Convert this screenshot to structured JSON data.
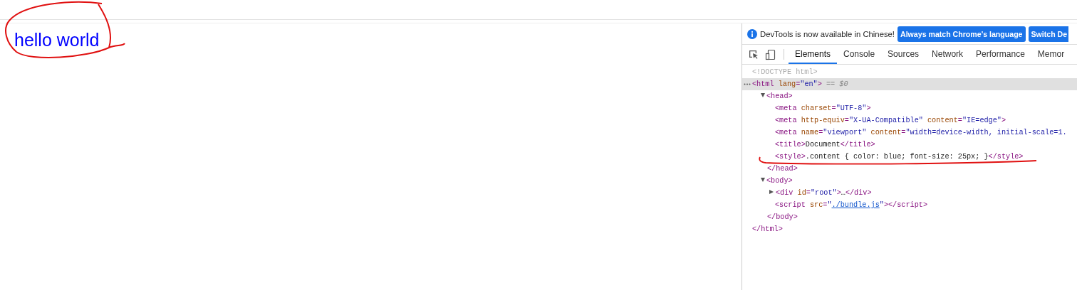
{
  "page": {
    "content": "hello world"
  },
  "devtools": {
    "infobar": {
      "message": "DevTools is now available in Chinese!",
      "buttons": [
        "Always match Chrome's language",
        "Switch De"
      ]
    },
    "tabs": [
      {
        "label": "Elements",
        "selected": true
      },
      {
        "label": "Console",
        "selected": false
      },
      {
        "label": "Sources",
        "selected": false
      },
      {
        "label": "Network",
        "selected": false
      },
      {
        "label": "Performance",
        "selected": false
      },
      {
        "label": "Memor",
        "selected": false
      }
    ],
    "dom_tree": [
      {
        "open": [
          {
            "kind": "doctype",
            "text": "<!DOCTYPE html>"
          }
        ]
      },
      {
        "selected": true,
        "open": [
          {
            "kind": "tag",
            "text": "<html"
          },
          {
            "kind": "attr",
            "text": " lang"
          },
          {
            "kind": "punct",
            "text": "="
          },
          {
            "kind": "value",
            "text": "\"en\""
          },
          {
            "kind": "tag",
            "text": ">"
          },
          {
            "kind": "ref",
            "text": " == $0"
          }
        ],
        "children": [
          {
            "expanded": true,
            "open": [
              {
                "kind": "tag",
                "text": "<head>"
              }
            ],
            "close": [
              {
                "kind": "tag",
                "text": "</head>"
              }
            ],
            "children": [
              {
                "open": [
                  {
                    "kind": "tag",
                    "text": "<meta"
                  },
                  {
                    "kind": "attr",
                    "text": " charset"
                  },
                  {
                    "kind": "punct",
                    "text": "="
                  },
                  {
                    "kind": "value",
                    "text": "\"UTF-8\""
                  },
                  {
                    "kind": "tag",
                    "text": ">"
                  }
                ]
              },
              {
                "open": [
                  {
                    "kind": "tag",
                    "text": "<meta"
                  },
                  {
                    "kind": "attr",
                    "text": " http-equiv"
                  },
                  {
                    "kind": "punct",
                    "text": "="
                  },
                  {
                    "kind": "value",
                    "text": "\"X-UA-Compatible\""
                  },
                  {
                    "kind": "attr",
                    "text": " content"
                  },
                  {
                    "kind": "punct",
                    "text": "="
                  },
                  {
                    "kind": "value",
                    "text": "\"IE=edge\""
                  },
                  {
                    "kind": "tag",
                    "text": ">"
                  }
                ]
              },
              {
                "open": [
                  {
                    "kind": "tag",
                    "text": "<meta"
                  },
                  {
                    "kind": "attr",
                    "text": " name"
                  },
                  {
                    "kind": "punct",
                    "text": "="
                  },
                  {
                    "kind": "value",
                    "text": "\"viewport\""
                  },
                  {
                    "kind": "attr",
                    "text": " content"
                  },
                  {
                    "kind": "punct",
                    "text": "="
                  },
                  {
                    "kind": "value",
                    "text": "\"width=device-width, initial-scale=1."
                  }
                ]
              },
              {
                "open": [
                  {
                    "kind": "tag",
                    "text": "<title>"
                  },
                  {
                    "kind": "text",
                    "text": "Document"
                  },
                  {
                    "kind": "tag",
                    "text": "</title>"
                  }
                ]
              },
              {
                "open": [
                  {
                    "kind": "tag",
                    "text": "<style>"
                  },
                  {
                    "kind": "text",
                    "text": ".content { color: blue; font-size: 25px; }"
                  },
                  {
                    "kind": "tag",
                    "text": "</style>"
                  }
                ]
              }
            ]
          },
          {
            "expanded": true,
            "open": [
              {
                "kind": "tag",
                "text": "<body>"
              }
            ],
            "close": [
              {
                "kind": "tag",
                "text": "</body>"
              }
            ],
            "children": [
              {
                "expanded": false,
                "open": [
                  {
                    "kind": "tag",
                    "text": "<div"
                  },
                  {
                    "kind": "attr",
                    "text": " id"
                  },
                  {
                    "kind": "punct",
                    "text": "="
                  },
                  {
                    "kind": "value",
                    "text": "\"root\""
                  },
                  {
                    "kind": "tag",
                    "text": ">"
                  },
                  {
                    "kind": "text",
                    "text": "…"
                  },
                  {
                    "kind": "tag",
                    "text": "</div>"
                  }
                ]
              },
              {
                "open": [
                  {
                    "kind": "tag",
                    "text": "<script"
                  },
                  {
                    "kind": "attr",
                    "text": " src"
                  },
                  {
                    "kind": "punct",
                    "text": "="
                  },
                  {
                    "kind": "value",
                    "text": "\""
                  },
                  {
                    "kind": "link",
                    "text": "./bundle.js"
                  },
                  {
                    "kind": "value",
                    "text": "\""
                  },
                  {
                    "kind": "tag",
                    "text": "></script>"
                  }
                ]
              }
            ]
          }
        ],
        "close": [
          {
            "kind": "tag",
            "text": "</html>"
          }
        ]
      }
    ]
  }
}
